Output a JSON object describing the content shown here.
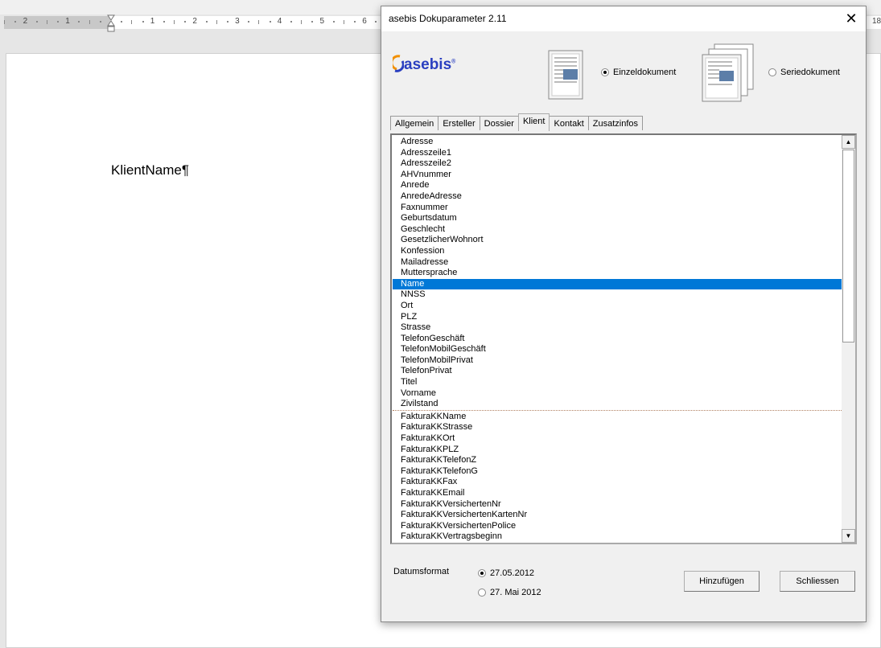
{
  "ruler": {
    "left_numbers": [
      "2",
      "1"
    ],
    "right_numbers": [
      "1",
      "2",
      "3",
      "4",
      "5",
      "6"
    ],
    "far_right": "18"
  },
  "document": {
    "text": "KlientName¶"
  },
  "dialog": {
    "title": "asebis Dokuparameter 2.11",
    "close_icon": "close-icon",
    "logo": "asebis",
    "doc_type": {
      "options": [
        {
          "label": "Einzeldokument",
          "selected": true
        },
        {
          "label": "Seriedokument",
          "selected": false
        }
      ]
    },
    "tabs": [
      {
        "label": "Allgemein"
      },
      {
        "label": "Ersteller"
      },
      {
        "label": "Dossier"
      },
      {
        "label": "Klient",
        "active": true
      },
      {
        "label": "Kontakt"
      },
      {
        "label": "Zusatzinfos"
      }
    ],
    "list": {
      "selected": "Name",
      "group1": [
        "Adresse",
        "Adresszeile1",
        "Adresszeile2",
        "AHVnummer",
        "Anrede",
        "AnredeAdresse",
        "Faxnummer",
        "Geburtsdatum",
        "Geschlecht",
        "GesetzlicherWohnort",
        "Konfession",
        "Mailadresse",
        "Muttersprache",
        "Name",
        "NNSS",
        "Ort",
        "PLZ",
        "Strasse",
        "TelefonGeschäft",
        "TelefonMobilGeschäft",
        "TelefonMobilPrivat",
        "TelefonPrivat",
        "Titel",
        "Vorname",
        "Zivilstand"
      ],
      "group2": [
        "FakturaKKName",
        "FakturaKKStrasse",
        "FakturaKKOrt",
        "FakturaKKPLZ",
        "FakturaKKTelefonZ",
        "FakturaKKTelefonG",
        "FakturaKKFax",
        "FakturaKKEmail",
        "FakturaKKVersichertenNr",
        "FakturaKKVersichertenKartenNr",
        "FakturaKKVersichertenPolice",
        "FakturaKKVertragsbeginn"
      ]
    },
    "date_format": {
      "label": "Datumsformat",
      "options": [
        {
          "label": "27.05.2012",
          "selected": true
        },
        {
          "label": "27. Mai 2012",
          "selected": false
        }
      ]
    },
    "buttons": {
      "add": "Hinzufügen",
      "close": "Schliessen"
    },
    "colors": {
      "selection": "#0078d7",
      "logo": "#2a3fc0"
    }
  }
}
